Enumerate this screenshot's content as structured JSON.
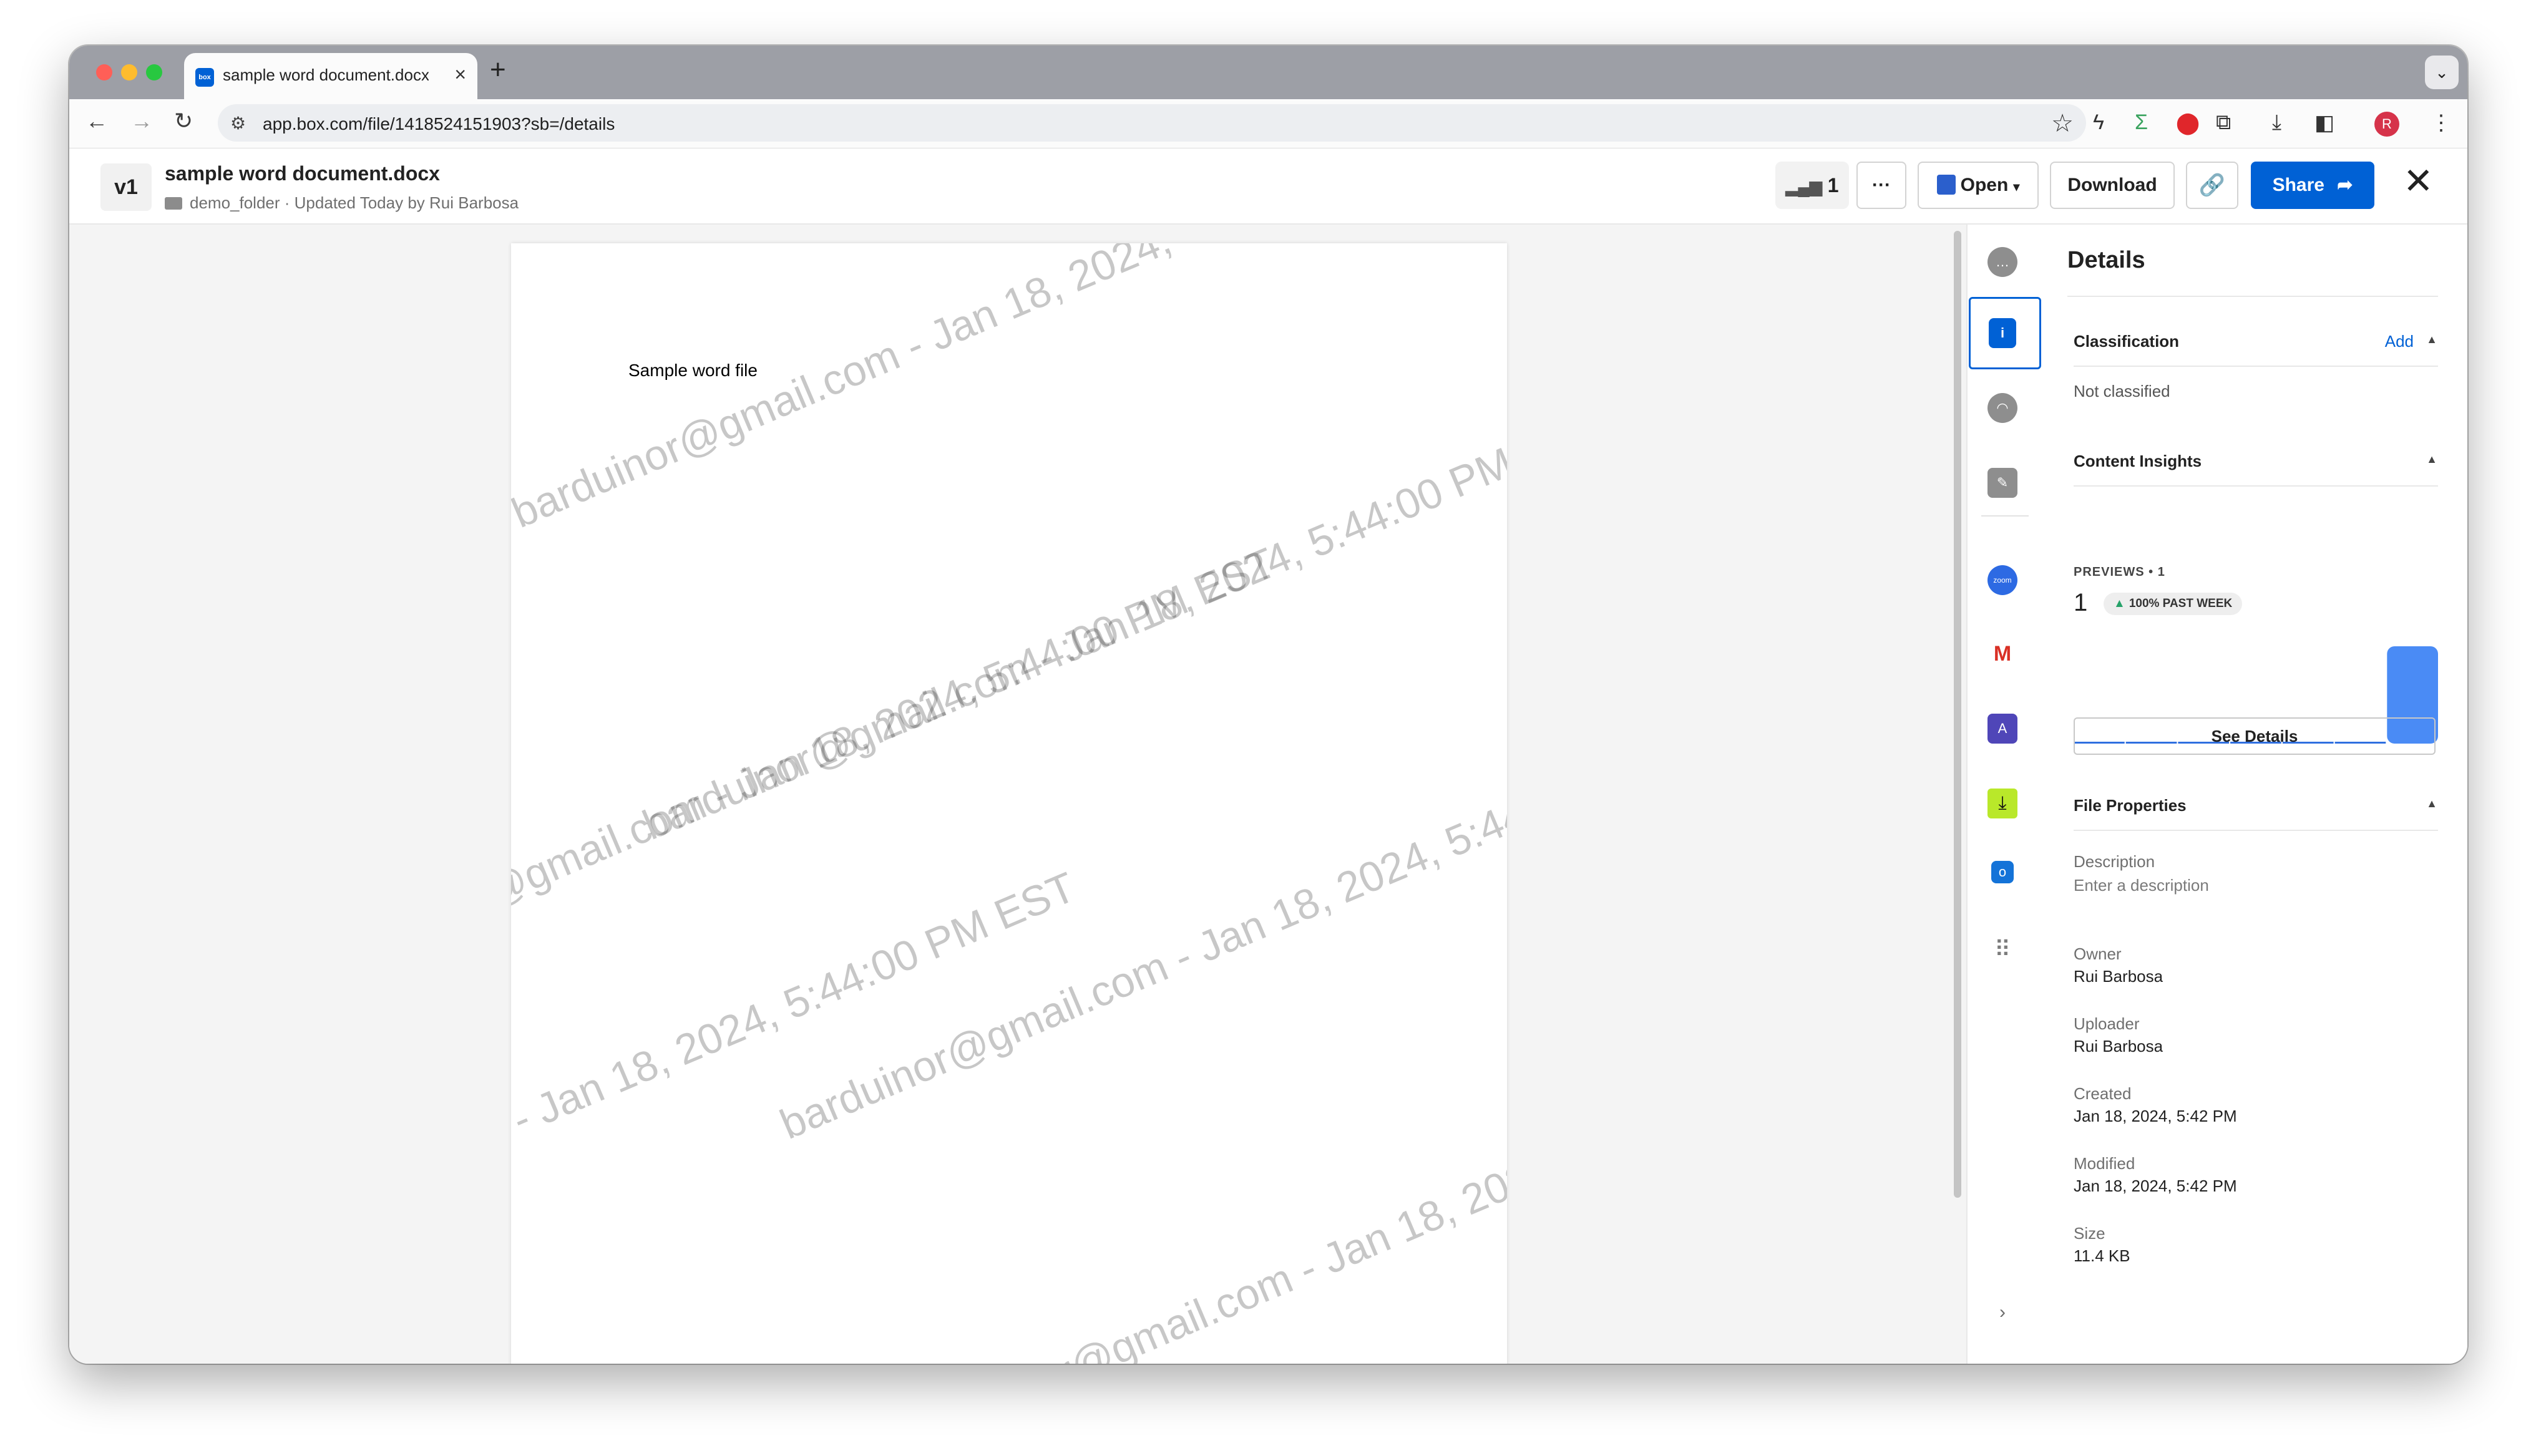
{
  "browser": {
    "tab_title": "sample word document.docx",
    "tab_favicon_text": "box",
    "url": "app.box.com/file/1418524151903?sb=/details",
    "profile_initial": "R"
  },
  "header": {
    "version_badge": "v1",
    "file_name": "sample word document.docx",
    "folder": "demo_folder",
    "updated": "Updated Today by Rui Barbosa",
    "views_count": "1",
    "more_label": "···",
    "open_label": "Open",
    "download_label": "Download",
    "share_label": "Share"
  },
  "document": {
    "body_text": "Sample word file",
    "watermark": "barduinor@gmail.com - Jan 18, 2024, 5:44:00 PM EST"
  },
  "details": {
    "title": "Details",
    "classification": {
      "heading": "Classification",
      "add_label": "Add",
      "value": "Not classified"
    },
    "insights": {
      "heading": "Content Insights",
      "previews_label": "PREVIEWS • 1",
      "count": "1",
      "trend": "100% PAST WEEK",
      "see_details": "See Details",
      "chart_data": {
        "type": "bar",
        "values": [
          0,
          0,
          0,
          0,
          0,
          0,
          1
        ],
        "ylim": [
          0,
          1
        ]
      }
    },
    "file_properties": {
      "heading": "File Properties",
      "description_label": "Description",
      "description_placeholder": "Enter a description",
      "owner_label": "Owner",
      "owner": "Rui Barbosa",
      "uploader_label": "Uploader",
      "uploader": "Rui Barbosa",
      "created_label": "Created",
      "created": "Jan 18, 2024, 5:42 PM",
      "modified_label": "Modified",
      "modified": "Jan 18, 2024, 5:42 PM",
      "size_label": "Size",
      "size": "11.4 KB"
    }
  },
  "colors": {
    "brand": "#0061d5",
    "chart_bar": "#4a8bf5"
  },
  "sidebar_icons": [
    "comment-icon",
    "info-icon",
    "activity-icon",
    "sign-icon",
    "zoom-icon",
    "gmail-icon",
    "acrobat-icon",
    "download-app-icon",
    "outlook-icon",
    "apps-grid-icon",
    "expand-chevron-icon"
  ]
}
